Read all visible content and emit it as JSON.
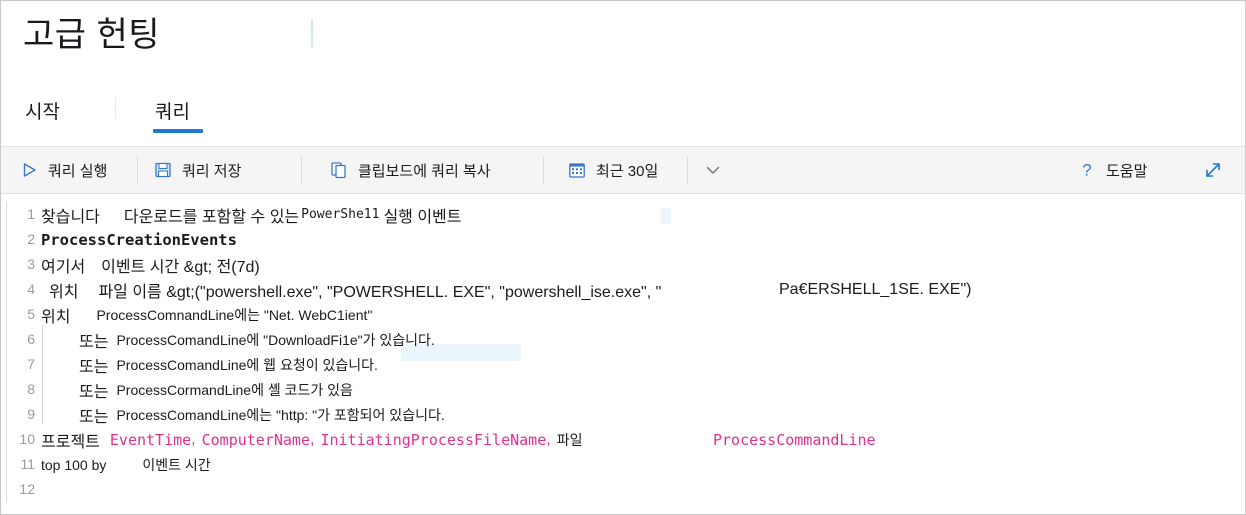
{
  "header": {
    "title": "고급 헌팅"
  },
  "tabs": [
    {
      "id": "start",
      "label": "시작",
      "selected": false
    },
    {
      "id": "query",
      "label": "쿼리",
      "selected": true
    }
  ],
  "toolbar": {
    "run_label": "쿼리 실행",
    "save_label": "쿼리 저장",
    "copy_label": "클립보드에 쿼리 복사",
    "timerange_label": "최근 30일",
    "help_label": "도움말",
    "icons": {
      "run": "play-icon",
      "save": "floppy-disk-icon",
      "copy": "copy-icon",
      "timerange": "calendar-icon",
      "chevron": "chevron-down-icon",
      "help": "question-mark-icon",
      "expand": "expand-diagonal-icon"
    },
    "accent_color": "#3c78c8",
    "background_color": "#f5f5f5"
  },
  "editor": {
    "line_numbers": [
      "1",
      "2",
      "3",
      "4",
      "5",
      "6",
      "7",
      "8",
      "9",
      "10",
      "11",
      "12"
    ],
    "identifier_color": "#e12f92",
    "lines": {
      "l1_a": "찾습니다",
      "l1_b": "다운로드를 포함할 수 있는",
      "l1_c": "PowerShe11",
      "l1_d": "실행 이벤트",
      "l2": "ProcessCreationEvents",
      "l3_a": "여기서",
      "l3_b": "이벤트 시간 &gt; 전(7d)",
      "l4_a": "위치",
      "l4_b": "파일 이름 &gt;(\"powershell.exe\", \"POWERSHELL. EXE\", \"powershell_ise.exe\", \"",
      "l4_c": "Pa€ERSHELL_1SE. EXE\")",
      "l5_a": "위치",
      "l5_b": "ProcessComnandLine에는 \"Net. WebC1ient\"",
      "l6_a": "또는",
      "l6_b": "ProcessComandLine에 \"DownloadFi1e\"가 있습니다.",
      "l7_a": "또는",
      "l7_b": "ProcessComandLine에 웹 요청이 있습니다.",
      "l8_a": "또는",
      "l8_b": "ProcessCormandLine에 셸 코드가 있음",
      "l9_a": "또는",
      "l9_b": "ProcessComandLine에는 \"http: \"가 포함되어 있습니다.",
      "l10_a": "프로젝트",
      "l10_b": "EventTime",
      "l10_c": "ComputerName",
      "l10_d": "InitiatingProcessFileName",
      "l10_e": "파일",
      "l10_f": "ProcessCommandLine",
      "l11_a": "top 100 by",
      "l11_b": "이벤트 시간",
      "l12": ""
    }
  }
}
